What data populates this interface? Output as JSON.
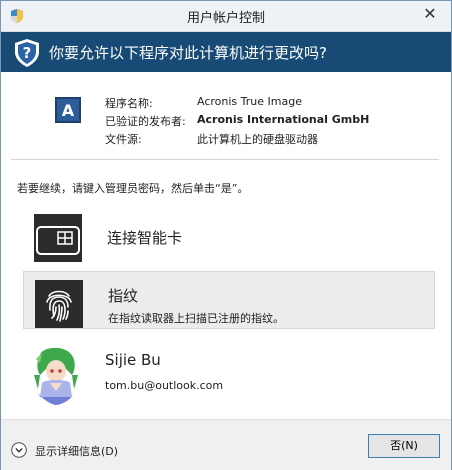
{
  "window": {
    "title": "用户帐户控制",
    "close_glyph": "✕"
  },
  "banner": {
    "question": "你要允许以下程序对此计算机进行更改吗?"
  },
  "program": {
    "icon_letter": "A",
    "name_label": "程序名称:",
    "name_value": "Acronis True Image",
    "publisher_label": "已验证的发布者:",
    "publisher_value": "Acronis International GmbH",
    "origin_label": "文件源:",
    "origin_value": "此计算机上的硬盘驱动器"
  },
  "prompt": "若要继续，请键入管理员密码，然后单击“是”。",
  "options": {
    "smartcard": {
      "title": "连接智能卡",
      "icon": "smartcard-icon"
    },
    "fingerprint": {
      "title": "指纹",
      "subtitle": "在指纹读取器上扫描已注册的指纹。",
      "icon": "fingerprint-icon",
      "selected": true
    },
    "account": {
      "name": "Sijie Bu",
      "email": "tom.bu@outlook.com"
    }
  },
  "footer": {
    "details_label": "显示详细信息(D)",
    "no_label": "否(N)"
  },
  "colors": {
    "banner": "#174a74",
    "icon_tile": "#2b2b2b",
    "selected_row": "#ececec"
  }
}
